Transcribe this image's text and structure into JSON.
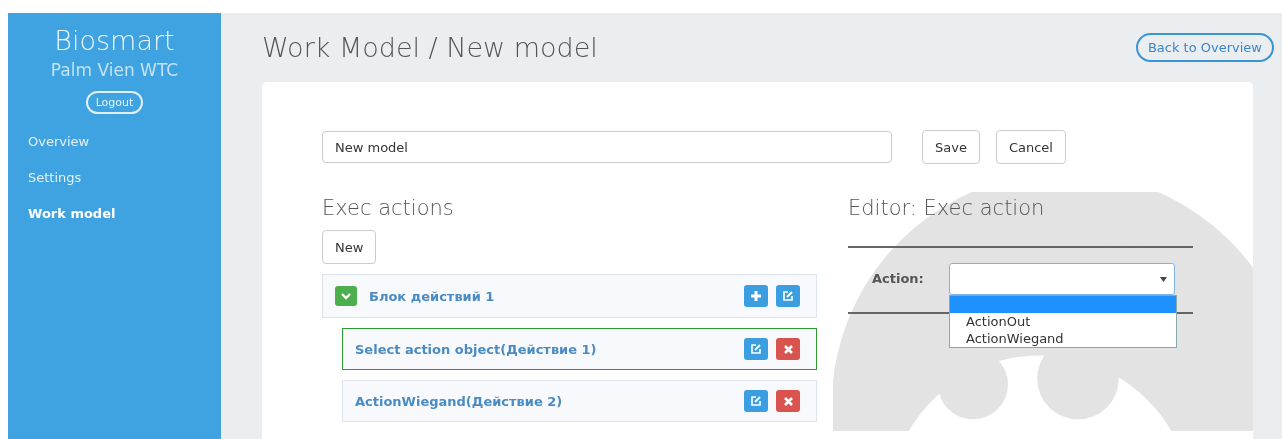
{
  "sidebar": {
    "brand": "Biosmart",
    "site": "Palm Vien WTC",
    "logout": "Logout",
    "items": [
      {
        "label": "Overview",
        "selected": false
      },
      {
        "label": "Settings",
        "selected": false
      },
      {
        "label": "Work model",
        "selected": true
      }
    ]
  },
  "header": {
    "title": "Work Model / New model",
    "back": "Back to Overview"
  },
  "form": {
    "name_value": "New model",
    "save": "Save",
    "cancel": "Cancel"
  },
  "exec_actions": {
    "title": "Exec actions",
    "new": "New",
    "tree": [
      {
        "label": "Блок действий 1",
        "expanded": true,
        "selected": false,
        "buttons": [
          {
            "kind": "add"
          },
          {
            "kind": "edit"
          }
        ],
        "children": [
          {
            "label": "Select action object(Действие 1)",
            "selected": true,
            "buttons": [
              {
                "kind": "edit"
              },
              {
                "kind": "delete"
              }
            ]
          },
          {
            "label": "ActionWiegand(Действие 2)",
            "selected": false,
            "buttons": [
              {
                "kind": "edit"
              },
              {
                "kind": "delete"
              }
            ]
          }
        ]
      }
    ]
  },
  "editor": {
    "title": "Editor: Exec action",
    "action_label": "Action:",
    "dropdown_open": true,
    "options": [
      {
        "selected": true
      },
      {
        "label": "ActionOut",
        "selected": false
      },
      {
        "label": "ActionWiegand",
        "selected": false
      }
    ]
  }
}
